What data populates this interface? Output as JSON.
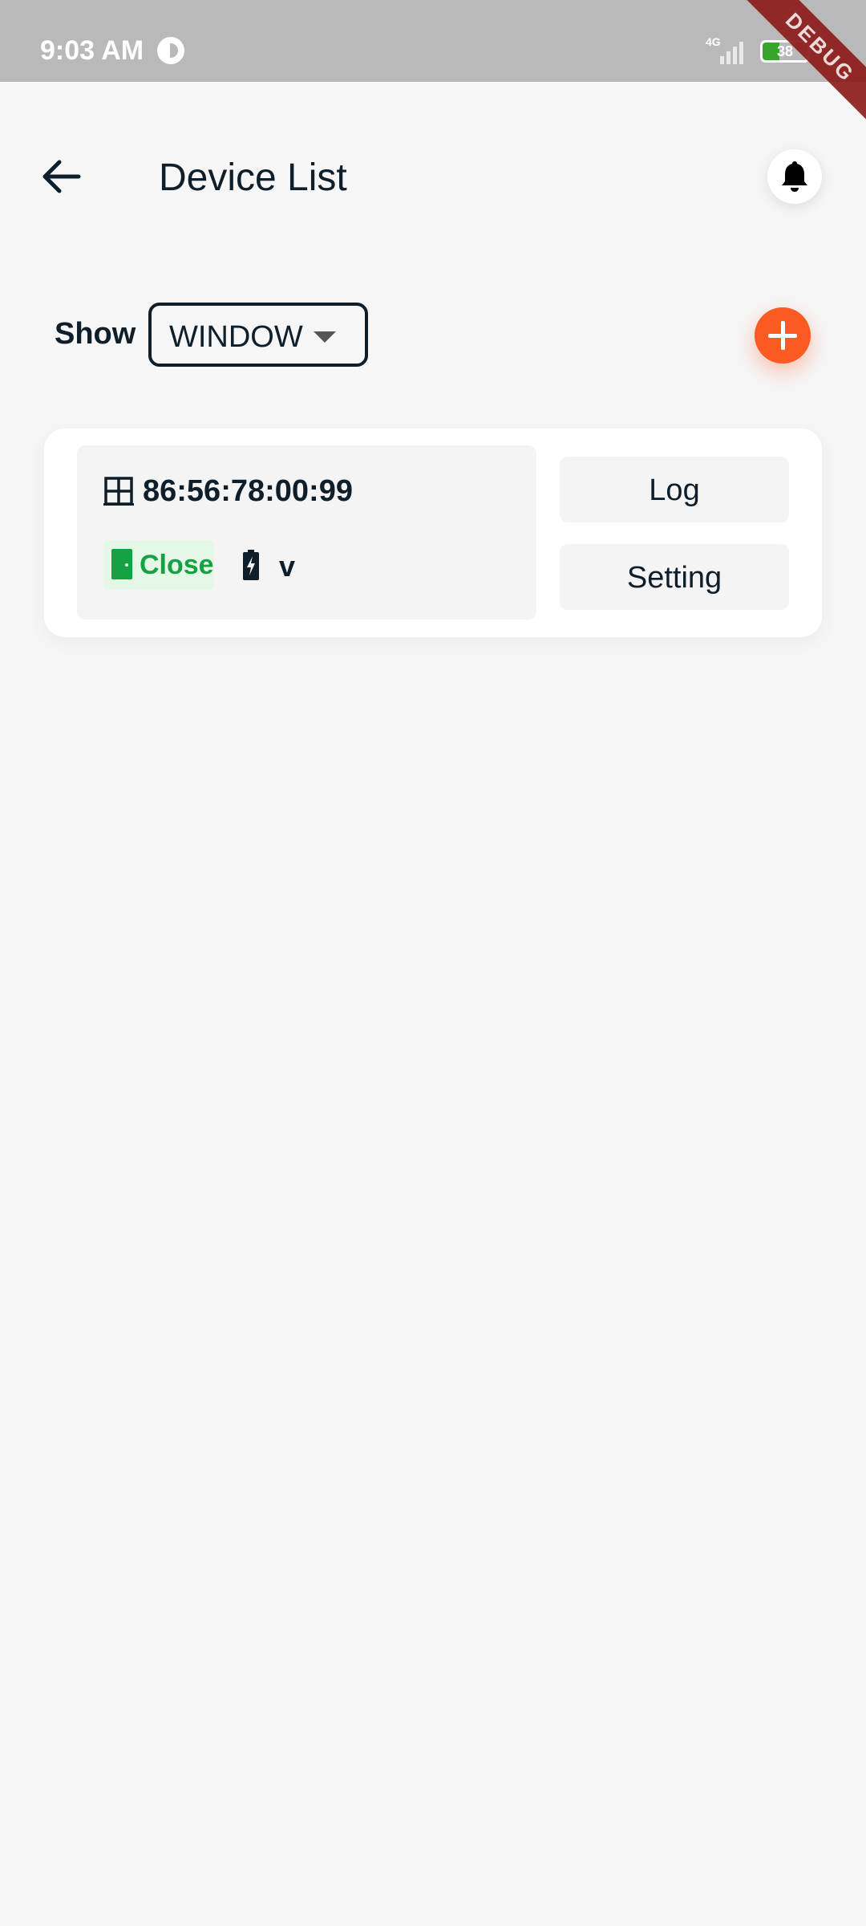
{
  "status_bar": {
    "time": "9:03 AM",
    "network": "4G",
    "battery_level": "38",
    "battery_fraction": 0.38,
    "debug_banner": "DEBUG"
  },
  "app_bar": {
    "title": "Device List",
    "back_icon": "arrow-left-icon",
    "notification_icon": "bell-icon"
  },
  "filter": {
    "label": "Show",
    "selected_type": "WINDOW",
    "add_icon": "plus-icon"
  },
  "devices": [
    {
      "type_icon": "window-icon",
      "mac": "86:56:78:00:99",
      "status_label": "Close",
      "status_icon": "door-icon",
      "battery_icon": "battery-charging-icon",
      "voltage": "v",
      "log_label": "Log",
      "setting_label": "Setting"
    }
  ],
  "colors": {
    "background": "#f6f6f6",
    "status_bar": "#b9b9b9",
    "accent": "#fb5a23",
    "primary_text": "#0e1f2b",
    "status_closed": "#16a145",
    "status_closed_bg": "#e5f7e7",
    "debug_ribbon": "#8e1c1c"
  }
}
